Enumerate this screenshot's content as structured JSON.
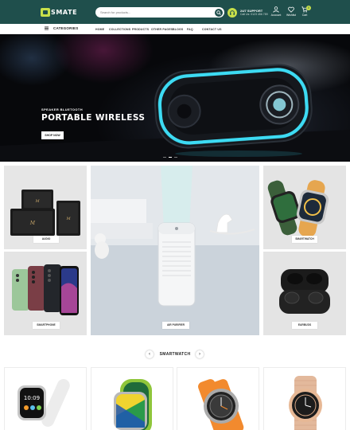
{
  "header": {
    "logo_text": "SMATE",
    "search": {
      "placeholder": "Search for products..."
    },
    "support": {
      "title": "24/7 SUPPORT",
      "phone": "Call Us: 0123 456 789"
    },
    "icons": [
      {
        "name": "account-icon",
        "label": "Account"
      },
      {
        "name": "wishlist-icon",
        "label": "Wishlist"
      },
      {
        "name": "cart-icon",
        "label": "Cart",
        "badge": "0"
      }
    ]
  },
  "nav": {
    "categories_label": "CATEGORIES",
    "items": [
      "HOME",
      "COLLECTIONS",
      "PRODUCTS",
      "OTHER PAGES",
      "BLOGS",
      "FAQ",
      "CONTACT US"
    ]
  },
  "hero": {
    "subtitle": "SPEAKER BLUETOOTH",
    "title": "PORTABLE WIRELESS",
    "button": "SHOP NOW",
    "slides": 3,
    "active_slide": 1
  },
  "categories": [
    {
      "label": "AUDIO"
    },
    {
      "label": "AIR PURIFIER"
    },
    {
      "label": "SMARTWATCH"
    },
    {
      "label": "SMARTPHONE"
    },
    {
      "label": "EARBUDS"
    }
  ],
  "section": {
    "title": "SMARTWATCH",
    "prev": "‹",
    "next": "›"
  },
  "colors": {
    "brand": "#1f4f4c",
    "accent": "#c8e04a",
    "speaker_glow": "#3fe6ff"
  }
}
